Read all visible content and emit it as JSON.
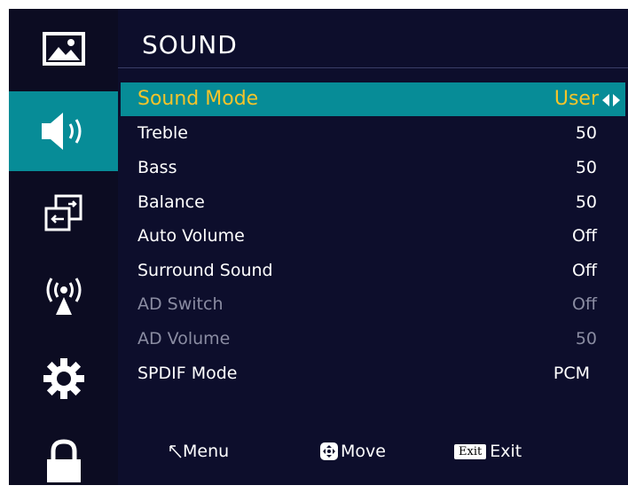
{
  "menu": {
    "title": "SOUND",
    "items": [
      {
        "label": "Sound Mode",
        "value": "User"
      },
      {
        "label": "Treble",
        "value": "50"
      },
      {
        "label": "Bass",
        "value": "50"
      },
      {
        "label": "Balance",
        "value": "50"
      },
      {
        "label": "Auto Volume",
        "value": "Off"
      },
      {
        "label": "Surround Sound",
        "value": "Off"
      },
      {
        "label": "AD Switch",
        "value": "Off"
      },
      {
        "label": "AD Volume",
        "value": "50"
      },
      {
        "label": "SPDIF Mode",
        "value": "PCM"
      }
    ]
  },
  "sidebar": {
    "icons": [
      "picture-icon",
      "speaker-icon",
      "input-source-icon",
      "network-icon",
      "gear-icon",
      "lock-icon"
    ],
    "active": "speaker-icon"
  },
  "footer": {
    "menu_label": "Menu",
    "move_label": "Move",
    "exit_key": "Exit",
    "exit_label": "Exit"
  },
  "colors": {
    "highlight": "#078c97",
    "selected_text": "#f5c42a",
    "panel": "#0d0e2c",
    "disabled_text": "#8a8ca2"
  }
}
